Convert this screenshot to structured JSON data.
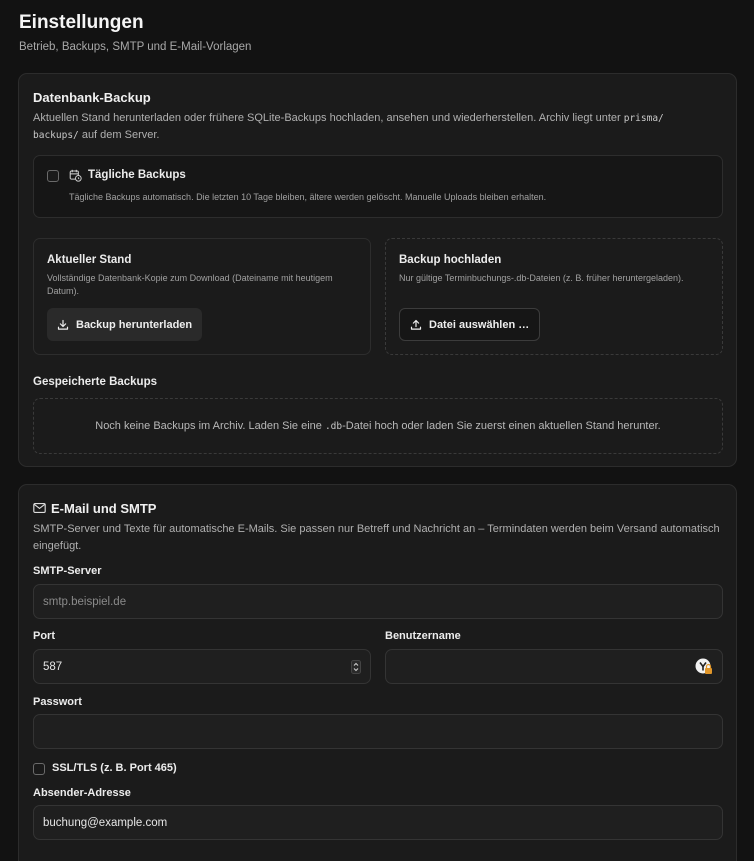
{
  "page": {
    "title": "Einstellungen",
    "subtitle": "Betrieb, Backups, SMTP und E-Mail-Vorlagen"
  },
  "backup": {
    "title": "Datenbank-Backup",
    "desc_part1": "Aktuellen Stand herunterladen oder frühere SQLite-Backups hochladen, ansehen und wiederherstellen. Archiv liegt unter ",
    "desc_code1": "prisma/",
    "desc_code2": "backups/",
    "desc_part2": " auf dem Server.",
    "daily": {
      "label": "Tägliche Backups",
      "desc": "Tägliche Backups automatisch. Die letzten 10 Tage bleiben, ältere werden gelöscht. Manuelle Uploads bleiben erhalten."
    },
    "current": {
      "title": "Aktueller Stand",
      "desc": "Vollständige Datenbank-Kopie zum Download (Dateiname mit heutigem Datum).",
      "button": "Backup herunterladen"
    },
    "upload": {
      "title": "Backup hochladen",
      "desc": "Nur gültige Terminbuchungs-.db-Dateien (z. B. früher heruntergeladen).",
      "button": "Datei auswählen …"
    },
    "saved": {
      "title": "Gespeicherte Backups",
      "empty_part1": "Noch keine Backups im Archiv. Laden Sie eine ",
      "empty_code": ".db",
      "empty_part2": "-Datei hoch oder laden Sie zuerst einen aktuellen Stand herunter."
    }
  },
  "smtp": {
    "title": "E-Mail und SMTP",
    "desc": "SMTP-Server und Texte für automatische E-Mails. Sie passen nur Betreff und Nachricht an – Termindaten werden beim Versand automatisch eingefügt.",
    "server_label": "SMTP-Server",
    "server_placeholder": "smtp.beispiel.de",
    "port_label": "Port",
    "port_value": "587",
    "username_label": "Benutzername",
    "username_value": "",
    "password_label": "Passwort",
    "password_value": "",
    "ssl_label": "SSL/TLS (z. B. Port 465)",
    "sender_label": "Absender-Adresse",
    "sender_value": "buchung@example.com"
  }
}
